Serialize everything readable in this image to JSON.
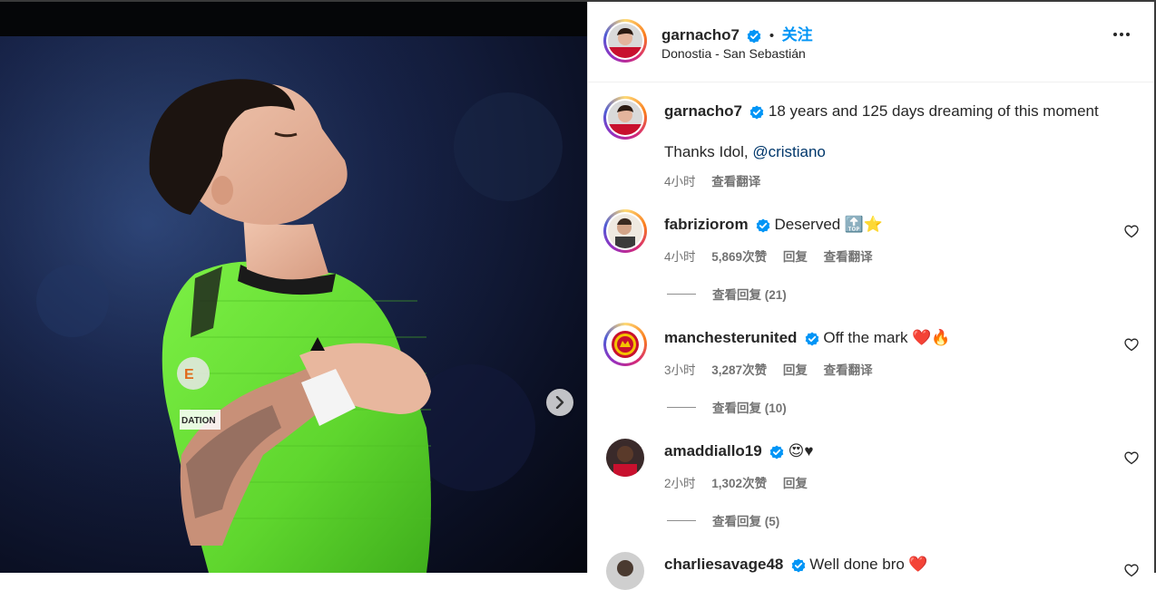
{
  "post": {
    "author": "garnacho7",
    "follow_label": "关注",
    "location": "Donostia - San Sebastián",
    "caption_line1": "18 years and 125 days dreaming of this moment",
    "caption_line2_prefix": "Thanks Idol, ",
    "caption_mention": "@cristiano",
    "time": "4小时",
    "translate_label": "查看翻译"
  },
  "comments": [
    {
      "user": "fabriziorom",
      "text": "Deserved",
      "emoji": "🔝⭐",
      "time": "4小时",
      "likes": "5,869次赞",
      "reply": "回复",
      "translate": "查看翻译",
      "view_replies": "查看回复 (21)"
    },
    {
      "user": "manchesterunited",
      "text": "Off the mark",
      "emoji": "❤️🔥",
      "time": "3小时",
      "likes": "3,287次赞",
      "reply": "回复",
      "translate": "查看翻译",
      "view_replies": "查看回复 (10)"
    },
    {
      "user": "amaddiallo19",
      "text": "",
      "emoji": "😍♥",
      "time": "2小时",
      "likes": "1,302次赞",
      "reply": "回复",
      "view_replies": "查看回复 (5)"
    },
    {
      "user": "charliesavage48",
      "text": "Well done bro",
      "emoji": "❤️"
    }
  ],
  "icons": {
    "verified": "verified-badge-icon",
    "more": "more-options-icon",
    "heart": "heart-outline-icon",
    "next": "chevron-right-icon"
  },
  "colors": {
    "accent": "#0095f6",
    "verified": "#0095f6",
    "jersey": "#6ee03a"
  }
}
